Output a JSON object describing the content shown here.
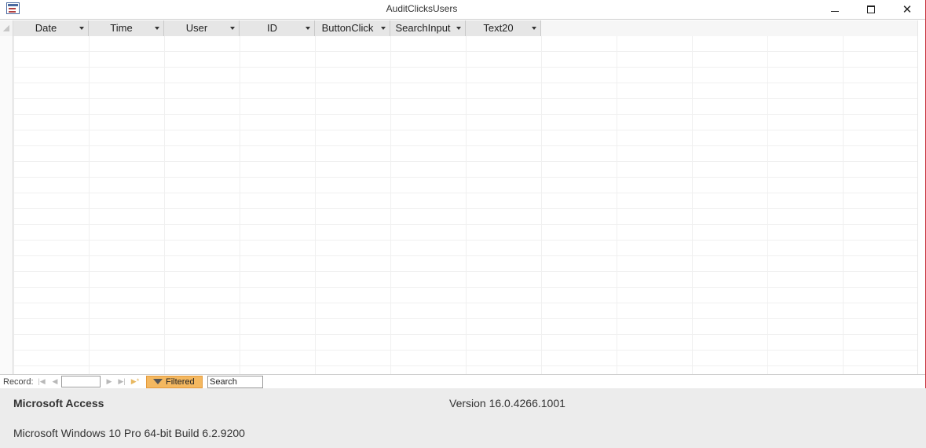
{
  "window": {
    "title": "AuditClicksUsers",
    "minimize_icon": "minimize-icon",
    "maximize_icon": "maximize-icon",
    "close_icon": "close-icon",
    "close_glyph": "✕"
  },
  "datasheet": {
    "columns": [
      {
        "label": "Date"
      },
      {
        "label": "Time"
      },
      {
        "label": "User"
      },
      {
        "label": "ID"
      },
      {
        "label": "ButtonClick"
      },
      {
        "label": "SearchInput"
      },
      {
        "label": "Text20"
      }
    ],
    "rows": []
  },
  "navigation": {
    "record_label": "Record:",
    "record_value": "",
    "first_glyph": "|◀",
    "prev_glyph": "◀",
    "next_glyph": "▶",
    "last_glyph": "▶|",
    "new_glyph": "▶*",
    "filter_label": "Filtered",
    "search_value": "Search"
  },
  "about": {
    "product": "Microsoft Access",
    "version": "Version 16.0.4266.1001",
    "os": "Microsoft Windows 10 Pro 64-bit Build 6.2.9200"
  },
  "colors": {
    "accent_border": "#c8323c",
    "filter_background": "#f4b860",
    "header_background": "#e6e6e6"
  }
}
